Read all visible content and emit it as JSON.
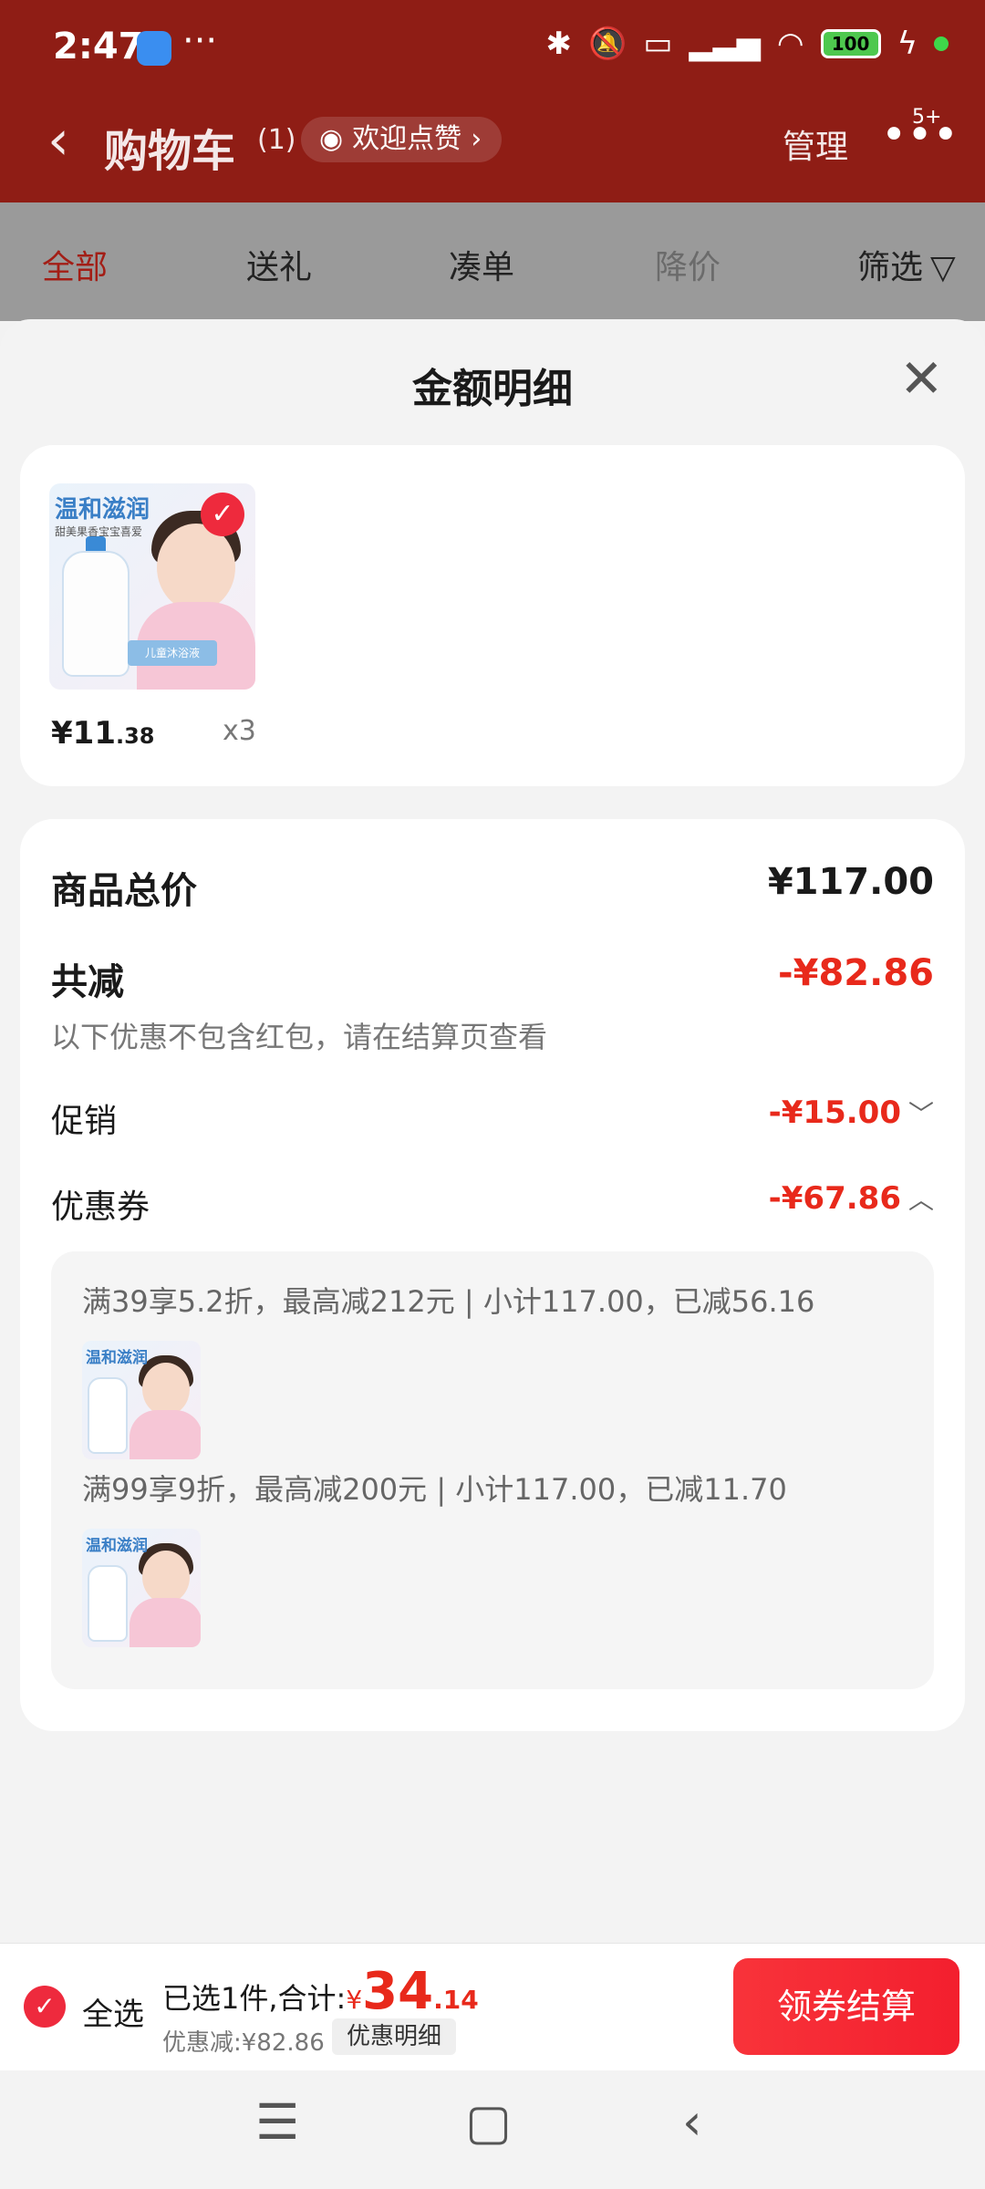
{
  "status_bar": {
    "time": "2:47",
    "more": "···",
    "battery": "100"
  },
  "header": {
    "back_icon": "‹",
    "title": "购物车",
    "count": "(1)",
    "like_label": "欢迎点赞",
    "manage": "管理",
    "menu_badge": "5+"
  },
  "filters": {
    "all": "全部",
    "gift": "送礼",
    "bundle": "凑单",
    "price_drop": "降价",
    "filter": "筛选"
  },
  "sheet": {
    "title": "金额明细",
    "product": {
      "image_title": "温和滋润",
      "image_sub": "甜美果香宝宝喜爱",
      "image_label": "儿童沐浴液",
      "price_main": "¥11",
      "price_dec": ".38",
      "qty": "x3"
    },
    "summary": {
      "total_label": "商品总价",
      "total_value": "¥117.00",
      "reduce_label": "共减",
      "reduce_value": "-¥82.86",
      "note": "以下优惠不包含红包，请在结算页查看",
      "promo_label": "促销",
      "promo_value": "-¥15.00",
      "coupon_label": "优惠券",
      "coupon_value": "-¥67.86"
    },
    "coupons": [
      {
        "text": "满39享5.2折，最高减212元 | 小计117.00，已减56.16",
        "thumb_title": "温和滋润"
      },
      {
        "text": "满99享9折，最高减200元 | 小计117.00，已减11.70",
        "thumb_title": "温和滋润"
      }
    ]
  },
  "bottom_bar": {
    "select_all": "全选",
    "selected_text": "已选1件,合计:",
    "currency": "¥",
    "total_int": "34",
    "total_dec": ".14",
    "discount": "优惠减:¥82.86",
    "detail_button": "优惠明细",
    "checkout": "领券结算"
  },
  "nav": {
    "menu": "☰",
    "home": "▢",
    "back": "‹"
  },
  "colors": {
    "accent_red": "#e8291b",
    "header_red": "#8f1d15",
    "checkout_red": "#f31f2e"
  }
}
